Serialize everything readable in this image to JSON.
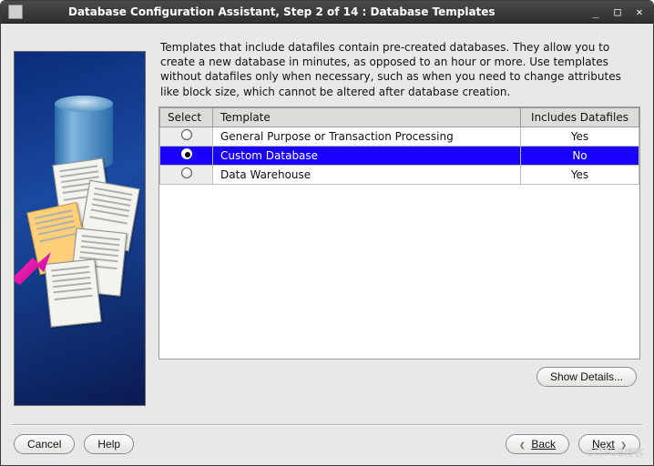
{
  "window": {
    "title": "Database Configuration Assistant, Step 2 of 14 : Database Templates"
  },
  "description": "Templates that include datafiles contain pre-created databases. They allow you to create a new database in minutes, as opposed to an hour or more. Use templates without datafiles only when necessary, such as when you need to change attributes like block size, which cannot be altered after database creation.",
  "table": {
    "columns": {
      "select": "Select",
      "template": "Template",
      "includes": "Includes Datafiles"
    },
    "rows": [
      {
        "template": "General Purpose or Transaction Processing",
        "includes": "Yes",
        "selected": false
      },
      {
        "template": "Custom Database",
        "includes": "No",
        "selected": true
      },
      {
        "template": "Data Warehouse",
        "includes": "Yes",
        "selected": false
      }
    ]
  },
  "buttons": {
    "show_details": "Show Details...",
    "cancel": "Cancel",
    "help": "Help",
    "back": "Back",
    "next": "Next"
  },
  "watermark": "©ITPUB博客"
}
